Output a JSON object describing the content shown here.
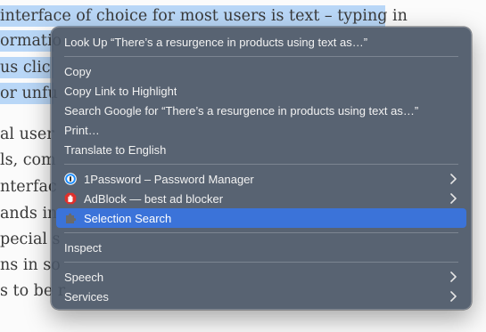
{
  "article": {
    "lines": [
      "interface of choice for most users is text – typing in",
      "ormatio",
      "us clic",
      "or unfu",
      "al user",
      "ls, com",
      "nterfac",
      "ands in",
      "pecial s",
      "ns in so",
      "s to be r"
    ]
  },
  "menu": {
    "look_up": "Look Up “There’s a resurgence in products using text as…”",
    "copy": "Copy",
    "copy_link": "Copy Link to Highlight",
    "search_google": "Search Google for “There’s a resurgence in products using text as…”",
    "print": "Print…",
    "translate": "Translate to English",
    "onepassword": "1Password – Password Manager",
    "adblock": "AdBlock — best ad blocker",
    "selection_search": "Selection Search",
    "inspect": "Inspect",
    "speech": "Speech",
    "services": "Services"
  },
  "colors": {
    "highlight": "#b9d7f7",
    "menu_selected": "#3b73d9",
    "adblock_red": "#e0302b",
    "onepassword_blue": "#1a8cff"
  },
  "icons": {
    "onepassword": "onepassword-icon",
    "adblock": "adblock-hand-icon",
    "selection_search": "puzzle-icon",
    "submenu": "chevron-right-icon"
  }
}
